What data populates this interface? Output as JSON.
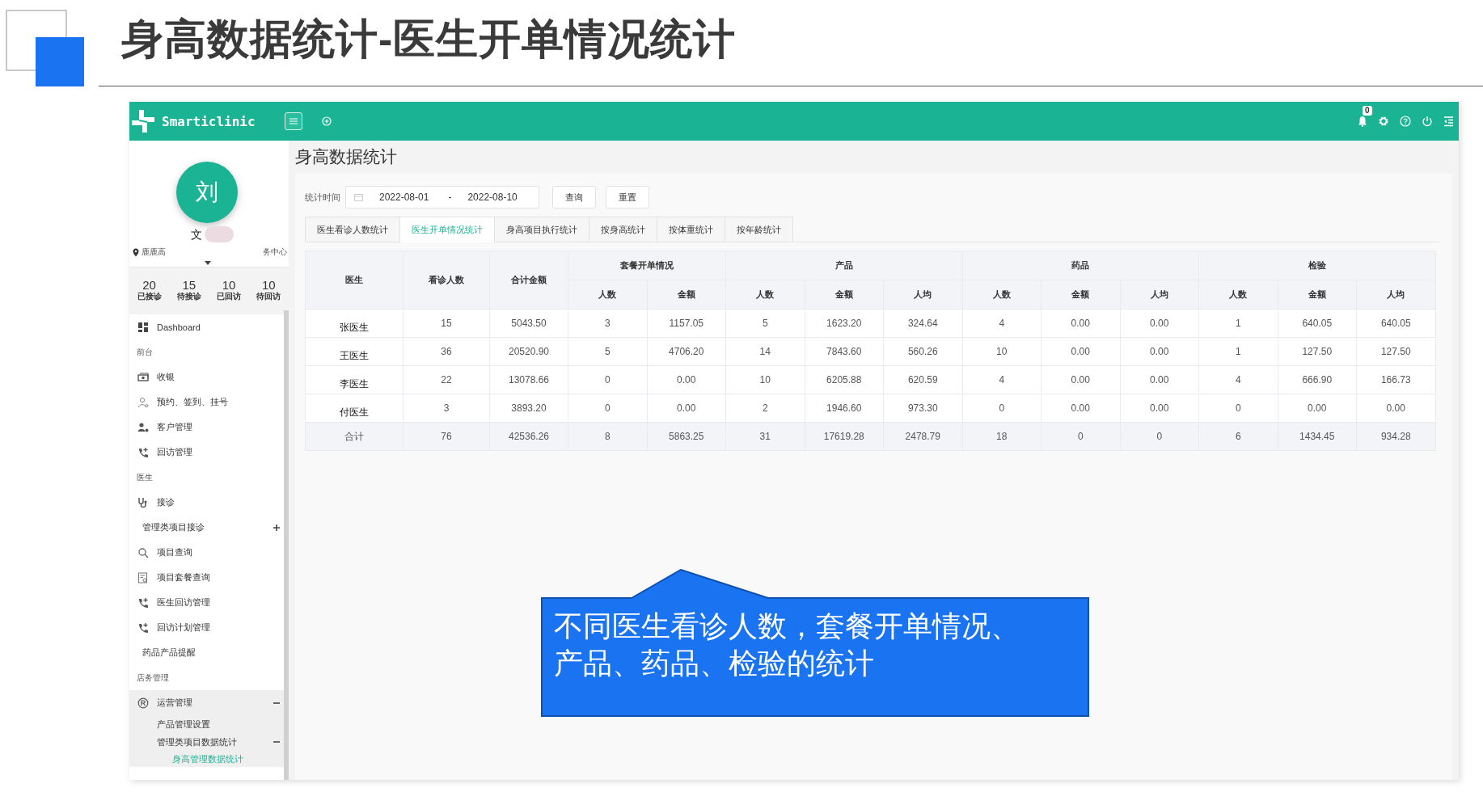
{
  "slide": {
    "title": "身高数据统计-医生开单情况统计"
  },
  "app": {
    "brand": "Smarticlinic",
    "notifications": "0"
  },
  "profile": {
    "avatar": "刘",
    "name": "文",
    "location": "鹿鹿高",
    "center": "务中心"
  },
  "stats": [
    {
      "value": "20",
      "label": "已接诊"
    },
    {
      "value": "15",
      "label": "待接诊"
    },
    {
      "value": "10",
      "label": "已回访"
    },
    {
      "value": "10",
      "label": "待回访"
    }
  ],
  "menu": [
    {
      "kind": "item",
      "label": "Dashboard"
    },
    {
      "kind": "section",
      "label": "前台"
    },
    {
      "kind": "item",
      "label": "收银"
    },
    {
      "kind": "item",
      "label": "预约、签到、挂号"
    },
    {
      "kind": "item",
      "label": "客户管理"
    },
    {
      "kind": "item",
      "label": "回访管理"
    },
    {
      "kind": "section",
      "label": "医生"
    },
    {
      "kind": "item",
      "label": "接诊"
    },
    {
      "kind": "sub",
      "label": "管理类项目接诊",
      "expanded": false
    },
    {
      "kind": "item",
      "label": "项目查询"
    },
    {
      "kind": "item",
      "label": "项目套餐查询"
    },
    {
      "kind": "item",
      "label": "医生回访管理"
    },
    {
      "kind": "item",
      "label": "回访计划管理"
    },
    {
      "kind": "sub",
      "label": "药品产品提醒"
    },
    {
      "kind": "section",
      "label": "店务管理"
    },
    {
      "kind": "item",
      "label": "运营管理",
      "expanded": true,
      "children": [
        {
          "label": "产品管理设置"
        },
        {
          "label": "管理类项目数据统计",
          "expanded": true,
          "children": [
            {
              "label": "身高管理数据统计",
              "selected": true
            }
          ]
        }
      ]
    }
  ],
  "page": {
    "title": "身高数据统计",
    "filter": {
      "label": "统计时间",
      "start": "2022-08-01",
      "separator": "-",
      "end": "2022-08-10"
    },
    "buttons": [
      "查询",
      "重置"
    ],
    "tabs": [
      {
        "label": "医生看诊人数统计",
        "selected": false
      },
      {
        "label": "医生开单情况统计",
        "selected": true
      },
      {
        "label": "身高项目执行统计",
        "selected": false
      },
      {
        "label": "按身高统计",
        "selected": false
      },
      {
        "label": "按体重统计",
        "selected": false
      },
      {
        "label": "按年龄统计",
        "selected": false
      }
    ],
    "table": {
      "groups": [
        {
          "label": "医生"
        },
        {
          "label": "看诊人数"
        },
        {
          "label": "合计金额"
        },
        {
          "label": "套餐开单情况",
          "columns": [
            "人数",
            "金额"
          ]
        },
        {
          "label": "产品",
          "columns": [
            "人数",
            "金额",
            "人均"
          ]
        },
        {
          "label": "药品",
          "columns": [
            "人数",
            "金额",
            "人均"
          ]
        },
        {
          "label": "检验",
          "columns": [
            "人数",
            "金额",
            "人均"
          ]
        }
      ],
      "rows": [
        [
          "张医生",
          "15",
          "5043.50",
          "3",
          "1157.05",
          "5",
          "1623.20",
          "324.64",
          "4",
          "0.00",
          "0.00",
          "1",
          "640.05",
          "640.05"
        ],
        [
          "王医生",
          "36",
          "20520.90",
          "5",
          "4706.20",
          "14",
          "7843.60",
          "560.26",
          "10",
          "0.00",
          "0.00",
          "1",
          "127.50",
          "127.50"
        ],
        [
          "李医生",
          "22",
          "13078.66",
          "0",
          "0.00",
          "10",
          "6205.88",
          "620.59",
          "4",
          "0.00",
          "0.00",
          "4",
          "666.90",
          "166.73"
        ],
        [
          "付医生",
          "3",
          "3893.20",
          "0",
          "0.00",
          "2",
          "1946.60",
          "973.30",
          "0",
          "0.00",
          "0.00",
          "0",
          "0.00",
          "0.00"
        ]
      ],
      "total": [
        "合计",
        "76",
        "42536.26",
        "8",
        "5863.25",
        "31",
        "17619.28",
        "2478.79",
        "18",
        "0",
        "0",
        "6",
        "1434.45",
        "934.28"
      ]
    }
  },
  "callout": {
    "text": "不同医生看诊人数，套餐开单情况、产品、药品、检验的统计"
  }
}
